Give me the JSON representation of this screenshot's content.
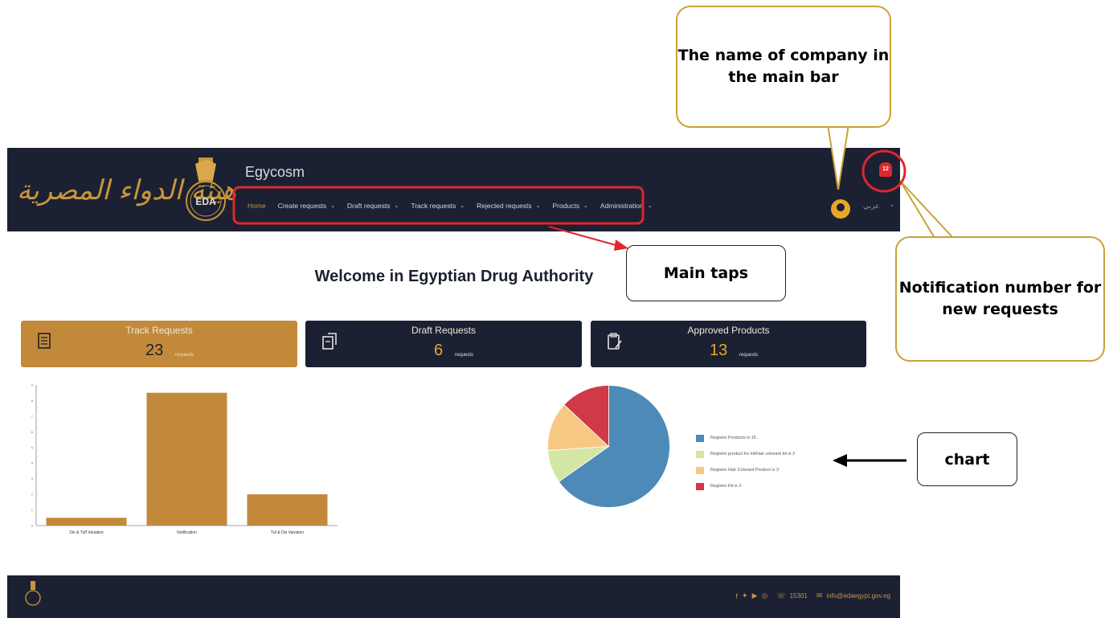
{
  "app": {
    "logo_text": "هيئة الدواء المصرية",
    "emblem_text": "EDA",
    "company_name": "Egycosm",
    "language_label": "عربي",
    "notification_count": "12"
  },
  "nav": {
    "items": [
      {
        "label": "Home",
        "active": true,
        "has_dropdown": false
      },
      {
        "label": "Create requests",
        "active": false,
        "has_dropdown": true
      },
      {
        "label": "Draft requests",
        "active": false,
        "has_dropdown": true
      },
      {
        "label": "Track requests",
        "active": false,
        "has_dropdown": true
      },
      {
        "label": "Rejected requests",
        "active": false,
        "has_dropdown": true
      },
      {
        "label": "Products",
        "active": false,
        "has_dropdown": true
      },
      {
        "label": "Administration",
        "active": false,
        "has_dropdown": true
      }
    ]
  },
  "welcome": "Welcome in Egyptian Drug Authority",
  "cards": [
    {
      "title": "Track Requests",
      "value": "23",
      "unit": "requests",
      "icon": "track-requests-icon"
    },
    {
      "title": "Draft Requests",
      "value": "6",
      "unit": "requests",
      "icon": "draft-requests-icon"
    },
    {
      "title": "Approved Products",
      "value": "13",
      "unit": "requests",
      "icon": "approved-products-icon"
    }
  ],
  "chart_data": [
    {
      "type": "bar",
      "categories": [
        "Dis & Tuff Variation",
        "Notification",
        "Tuf & Dis Variation"
      ],
      "values": [
        0.5,
        8.5,
        2
      ],
      "ylim": [
        0,
        9
      ],
      "yticks": [
        "0",
        "1",
        "2",
        "3",
        "4",
        "5",
        "6",
        "7",
        "8",
        "9"
      ],
      "color": "#c3893a",
      "grid": false
    },
    {
      "type": "pie",
      "labels": [
        "Register Products is 15",
        "Register product for kit/Hair colorant kit is 2",
        "Register Hair Colorant Product is 3",
        "Register Kit is 3"
      ],
      "values": [
        15,
        2,
        3,
        3
      ],
      "colors": [
        "#4d8ab8",
        "#d3e6a4",
        "#f7c884",
        "#cf3a46"
      ],
      "legend_position": "right"
    }
  ],
  "footer": {
    "phone": "15301",
    "email": "info@edaegypt.gov.eg",
    "social_icons": [
      "facebook-icon",
      "twitter-icon",
      "youtube-icon",
      "instagram-icon"
    ]
  },
  "annotations": {
    "company_callout": "The name of company in the main bar",
    "notification_callout": "Notification number for new requests",
    "tabs_callout": "Main taps",
    "chart_callout": "chart"
  },
  "colors": {
    "header_bg": "#1b2132",
    "accent_gold": "#c3893a",
    "annotation_red": "#e0262d",
    "callout_border": "#c8a13a"
  }
}
